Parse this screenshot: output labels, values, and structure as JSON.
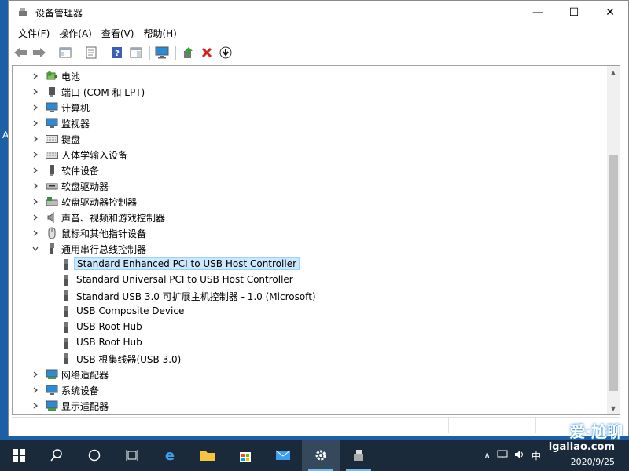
{
  "window": {
    "title": "设备管理器",
    "controls": {
      "minimize": "—",
      "maximize": "☐",
      "close": "✕"
    }
  },
  "menu": [
    {
      "label": "文件(F)"
    },
    {
      "label": "操作(A)"
    },
    {
      "label": "查看(V)"
    },
    {
      "label": "帮助(H)"
    }
  ],
  "toolbar": [
    {
      "icon": "back-arrow-icon"
    },
    {
      "icon": "forward-arrow-icon"
    },
    {
      "icon": "show-hide-tree-icon"
    },
    {
      "icon": "properties-icon"
    },
    {
      "icon": "help-icon"
    },
    {
      "icon": "action-pane-icon"
    },
    {
      "icon": "monitor-scan-icon"
    },
    {
      "icon": "update-driver-icon"
    },
    {
      "icon": "uninstall-device-icon"
    },
    {
      "icon": "download-icon"
    }
  ],
  "tree": {
    "categories_before": [
      {
        "label": "电池",
        "icon": "battery-icon"
      },
      {
        "label": "端口 (COM 和 LPT)",
        "icon": "port-icon"
      },
      {
        "label": "计算机",
        "icon": "computer-icon"
      },
      {
        "label": "监视器",
        "icon": "monitor-icon"
      },
      {
        "label": "键盘",
        "icon": "keyboard-icon"
      },
      {
        "label": "人体学输入设备",
        "icon": "hid-icon"
      },
      {
        "label": "软件设备",
        "icon": "software-device-icon"
      },
      {
        "label": "软盘驱动器",
        "icon": "floppy-drive-icon"
      },
      {
        "label": "软盘驱动器控制器",
        "icon": "floppy-controller-icon"
      },
      {
        "label": "声音、视频和游戏控制器",
        "icon": "speaker-icon"
      },
      {
        "label": "鼠标和其他指针设备",
        "icon": "mouse-icon"
      }
    ],
    "expanded_category": {
      "label": "通用串行总线控制器",
      "icon": "usb-icon"
    },
    "usb_children": [
      {
        "label": "Standard Enhanced PCI to USB Host Controller",
        "selected": true
      },
      {
        "label": "Standard Universal PCI to USB Host Controller"
      },
      {
        "label": "Standard USB 3.0 可扩展主机控制器 - 1.0 (Microsoft)"
      },
      {
        "label": "USB Composite Device"
      },
      {
        "label": "USB Root Hub"
      },
      {
        "label": "USB Root Hub"
      },
      {
        "label": "USB 根集线器(USB 3.0)"
      }
    ],
    "categories_after": [
      {
        "label": "网络适配器",
        "icon": "network-adapter-icon"
      },
      {
        "label": "系统设备",
        "icon": "system-device-icon"
      },
      {
        "label": "显示适配器",
        "icon": "display-adapter-icon"
      }
    ]
  },
  "desktop": {
    "edge_letter": "A"
  },
  "taskbar": {
    "items": [
      {
        "icon": "windows-start-icon"
      },
      {
        "icon": "search-icon"
      },
      {
        "icon": "cortana-icon"
      },
      {
        "icon": "task-view-icon"
      },
      {
        "icon": "edge-browser-icon"
      },
      {
        "icon": "file-explorer-icon"
      },
      {
        "icon": "store-icon"
      },
      {
        "icon": "mail-icon"
      },
      {
        "icon": "settings-icon"
      },
      {
        "icon": "device-manager-icon"
      }
    ],
    "tray": {
      "chevron": "∧",
      "ime": "中",
      "date": "2020/9/25"
    }
  },
  "watermark": {
    "text": "爱·尬聊",
    "url": "igaliao.com"
  }
}
